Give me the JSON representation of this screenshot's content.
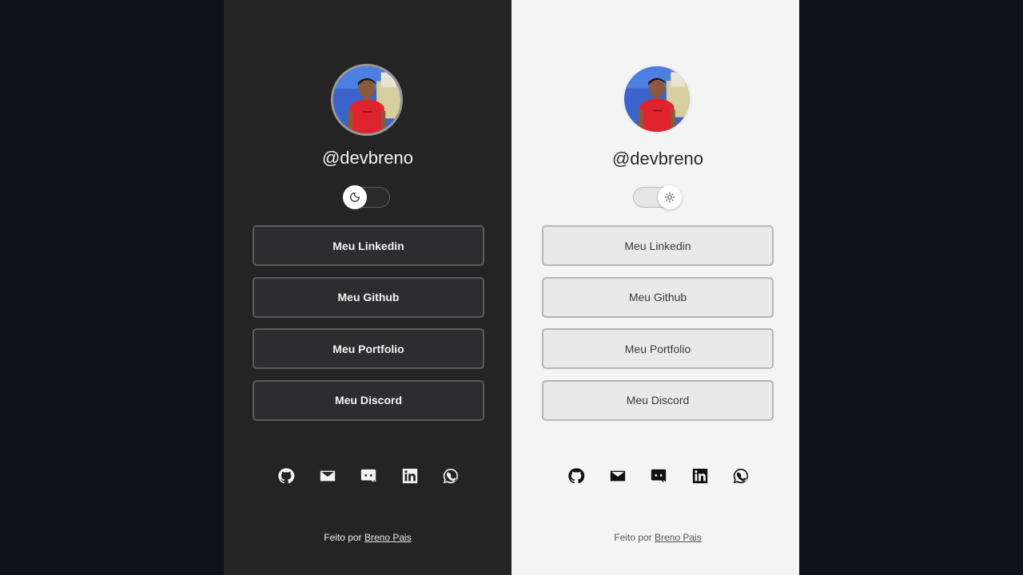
{
  "colors": {
    "background": "#0d111a",
    "dark_panel": "#242424",
    "light_panel": "#f4f4f4",
    "dark_button": "#2d2d2f",
    "light_button": "#e9e9e9"
  },
  "dark_theme": {
    "username": "@devbreno",
    "theme_toggle_icon": "moon-icon",
    "links": [
      {
        "label": "Meu Linkedin"
      },
      {
        "label": "Meu Github"
      },
      {
        "label": "Meu Portfolio"
      },
      {
        "label": "Meu Discord"
      }
    ],
    "social_icons": [
      "github-icon",
      "mail-icon",
      "discord-icon",
      "linkedin-icon",
      "whatsapp-icon"
    ],
    "footer_prefix": "Feito por",
    "footer_author": "Breno Pais"
  },
  "light_theme": {
    "username": "@devbreno",
    "theme_toggle_icon": "sun-icon",
    "links": [
      {
        "label": "Meu Linkedin"
      },
      {
        "label": "Meu Github"
      },
      {
        "label": "Meu Portfolio"
      },
      {
        "label": "Meu Discord"
      }
    ],
    "social_icons": [
      "github-icon",
      "mail-icon",
      "discord-icon",
      "linkedin-icon",
      "whatsapp-icon"
    ],
    "footer_prefix": "Feito por",
    "footer_author": "Breno Pais"
  }
}
